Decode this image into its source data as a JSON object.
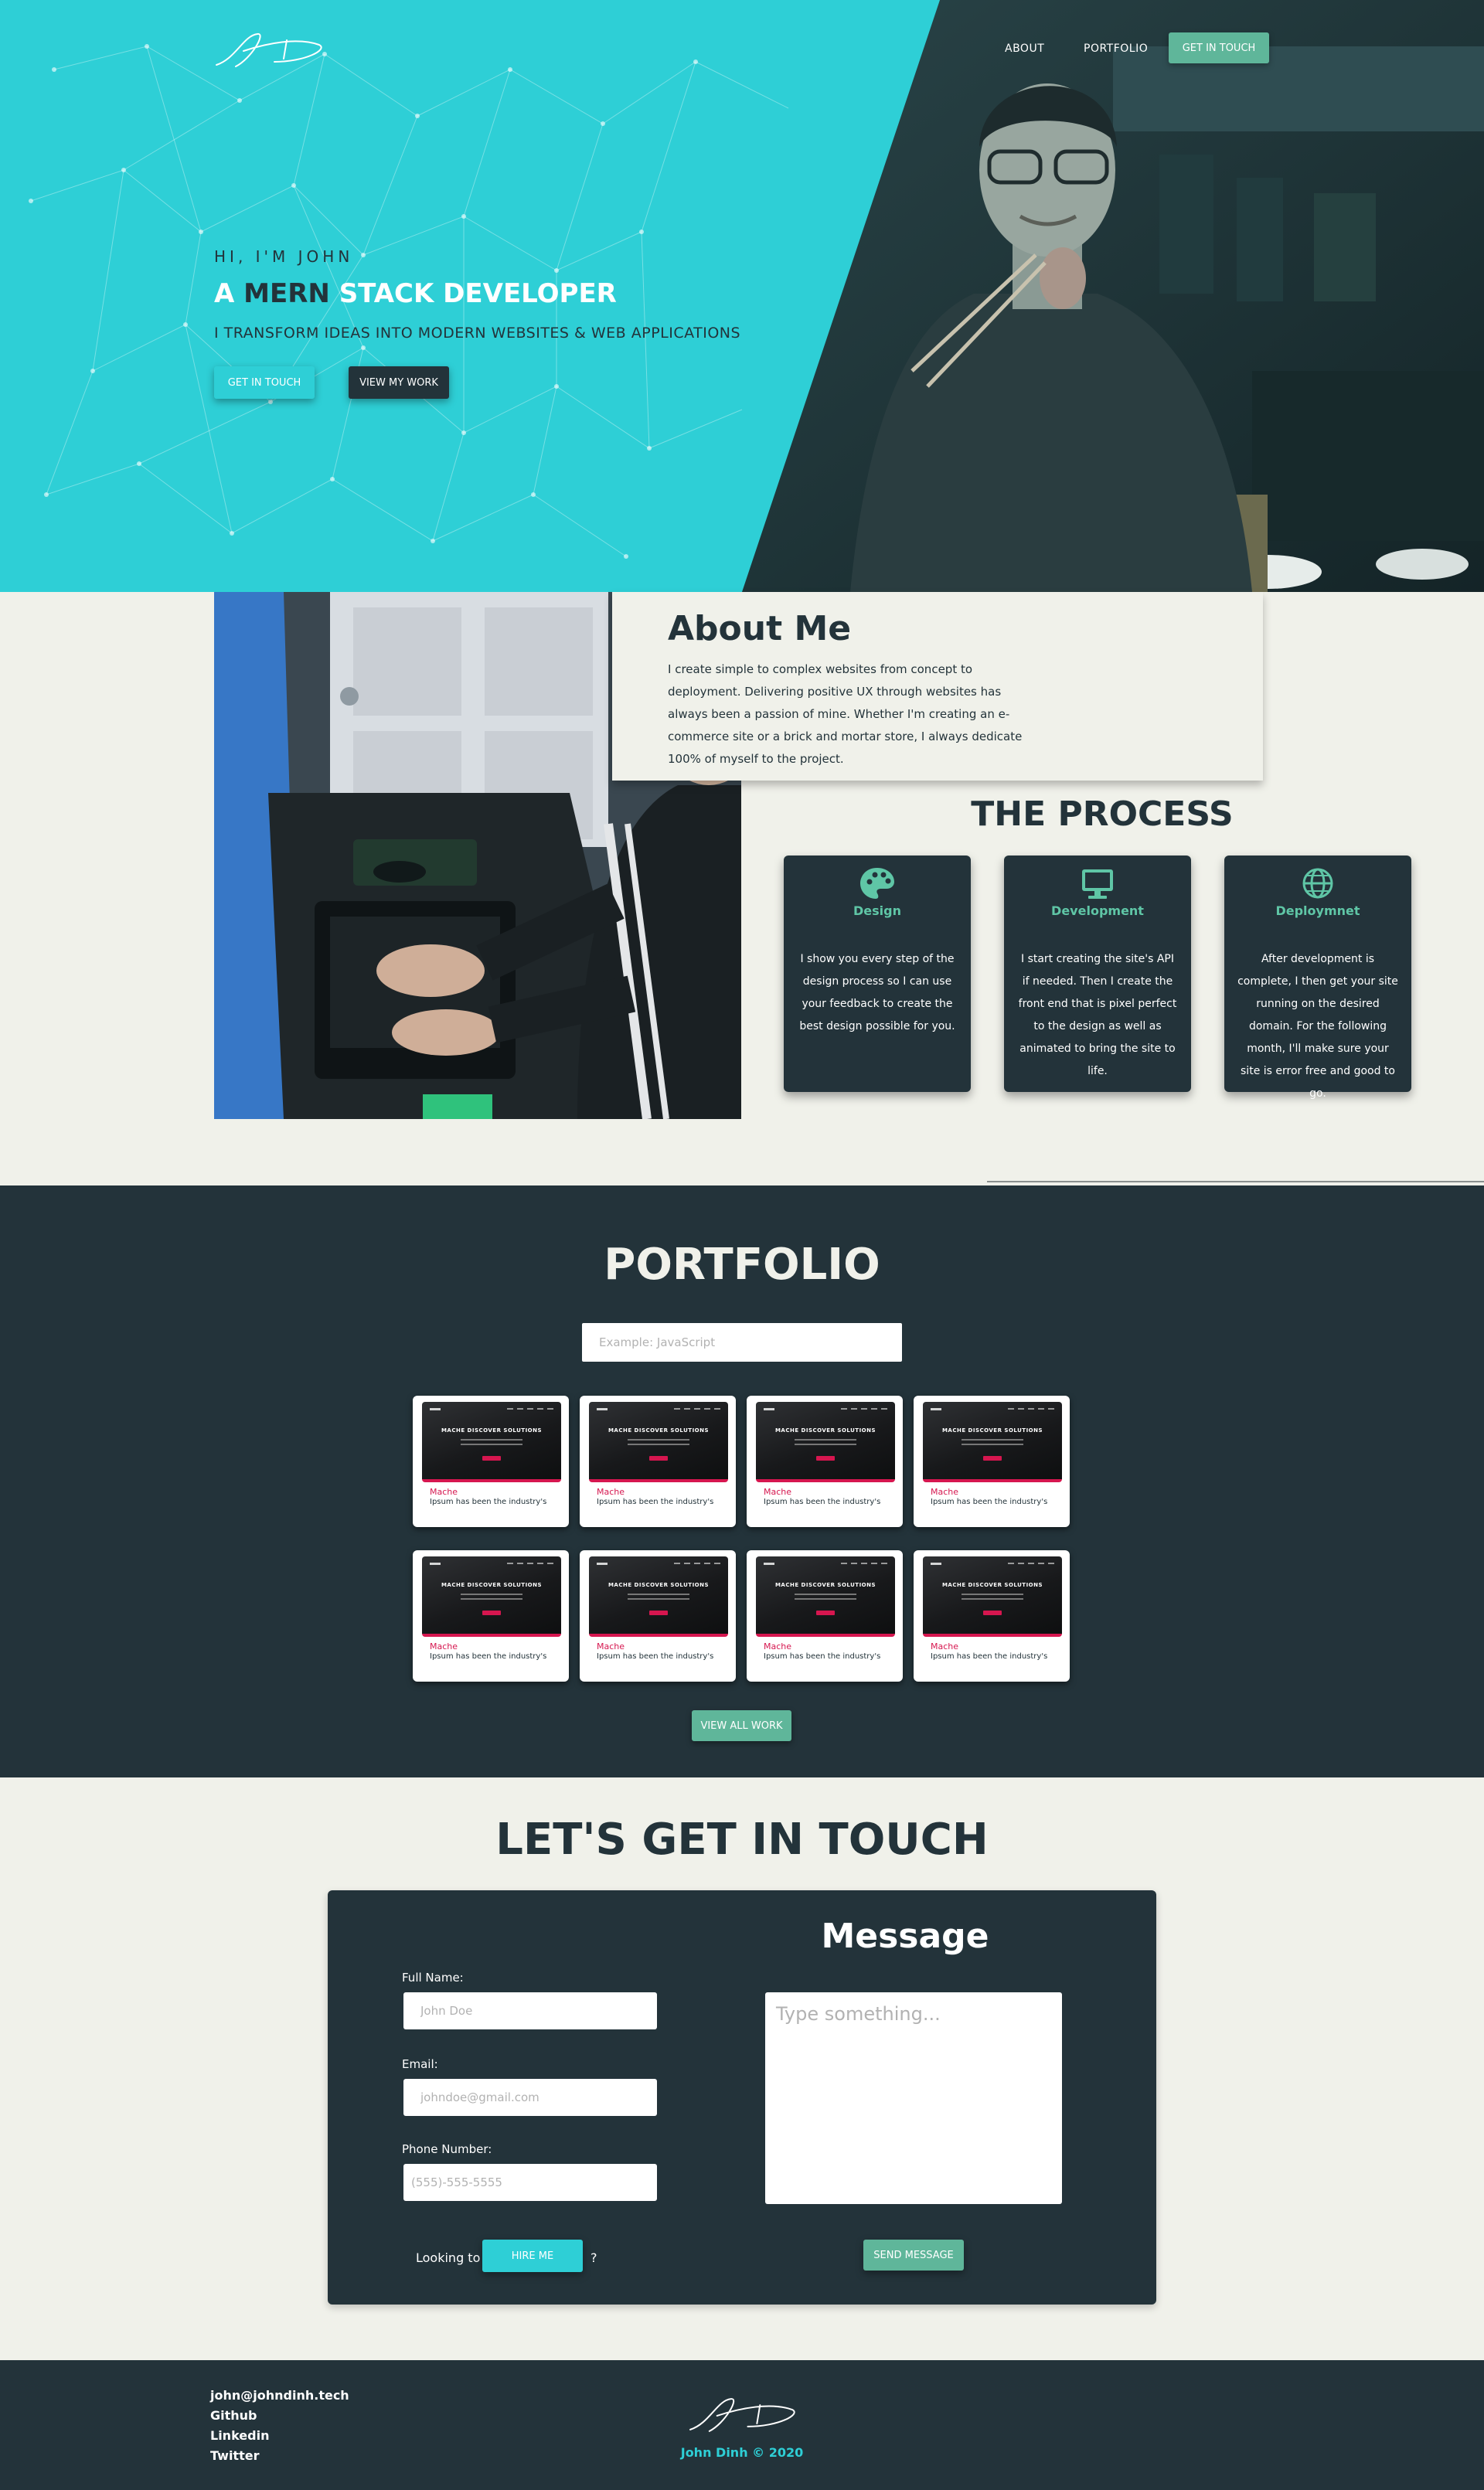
{
  "nav": {
    "about": "ABOUT",
    "portfolio": "PORTFOLIO",
    "cta": "GET IN TOUCH",
    "logo_icon": "signature-logo"
  },
  "hero": {
    "kicker": "HI, I'M JOHN",
    "title_pre": "A ",
    "title_accent": "MERN",
    "title_post": " STACK DEVELOPER",
    "subtitle": "I TRANSFORM IDEAS INTO MODERN WEBSITES & WEB APPLICATIONS",
    "btn_touch": "GET IN TOUCH",
    "btn_work": "VIEW MY WORK"
  },
  "about": {
    "title": "About Me",
    "text": "I create simple to complex websites from concept to deployment. Delivering positive UX through websites has always been a passion of mine. Whether I'm creating an e-commerce site or a brick and mortar store, I always dedicate 100% of myself to the project."
  },
  "process": {
    "title": "THE PROCESS",
    "steps": [
      {
        "name": "Design",
        "icon": "palette-icon",
        "text": "I show you every step of the design process so I can use your feedback to create the best design possible for you."
      },
      {
        "name": "Development",
        "icon": "monitor-icon",
        "text": "I start creating the site's API if needed. Then I create the front end that is pixel perfect to the design as well as animated to bring the site to life."
      },
      {
        "name": "Deploymnet",
        "icon": "globe-icon",
        "text": "After development is complete, I then get your site running on the desired domain. For the following month, I'll make sure your site is error free and good to go."
      }
    ]
  },
  "portfolio": {
    "title": "PORTFOLIO",
    "search_placeholder": "Example: JavaScript",
    "items": [
      {
        "name": "Mache",
        "desc": "Ipsum has been the industry's",
        "thumb_title": "MACHE DISCOVER SOLUTIONS"
      },
      {
        "name": "Mache",
        "desc": "Ipsum has been the industry's",
        "thumb_title": "MACHE DISCOVER SOLUTIONS"
      },
      {
        "name": "Mache",
        "desc": "Ipsum has been the industry's",
        "thumb_title": "MACHE DISCOVER SOLUTIONS"
      },
      {
        "name": "Mache",
        "desc": "Ipsum has been the industry's",
        "thumb_title": "MACHE DISCOVER SOLUTIONS"
      },
      {
        "name": "Mache",
        "desc": "Ipsum has been the industry's",
        "thumb_title": "MACHE DISCOVER SOLUTIONS"
      },
      {
        "name": "Mache",
        "desc": "Ipsum has been the industry's",
        "thumb_title": "MACHE DISCOVER SOLUTIONS"
      },
      {
        "name": "Mache",
        "desc": "Ipsum has been the industry's",
        "thumb_title": "MACHE DISCOVER SOLUTIONS"
      },
      {
        "name": "Mache",
        "desc": "Ipsum has been the industry's",
        "thumb_title": "MACHE DISCOVER SOLUTIONS"
      }
    ],
    "view_all": "VIEW ALL WORK"
  },
  "contact": {
    "title": "LET'S GET IN TOUCH",
    "full_name_label": "Full Name:",
    "full_name_placeholder": "John Doe",
    "email_label": "Email:",
    "email_placeholder": "johndoe@gmail.com",
    "phone_label": "Phone Number:",
    "phone_placeholder": "(555)-555-5555",
    "message_title": "Message",
    "message_placeholder": "Type something...",
    "looking": "Looking to",
    "hire": "HIRE ME",
    "qmark": "?",
    "send": "SEND MESSAGE"
  },
  "footer": {
    "email": "john@johndinh.tech",
    "github": "Github",
    "linkedin": "Linkedin",
    "twitter": "Twitter",
    "copyright": "John Dinh © 2020"
  },
  "colors": {
    "teal": "#2ecfd6",
    "dark": "#23333a",
    "green": "#5fb69a",
    "cream": "#f0f1ea",
    "pink": "#d6164f"
  }
}
